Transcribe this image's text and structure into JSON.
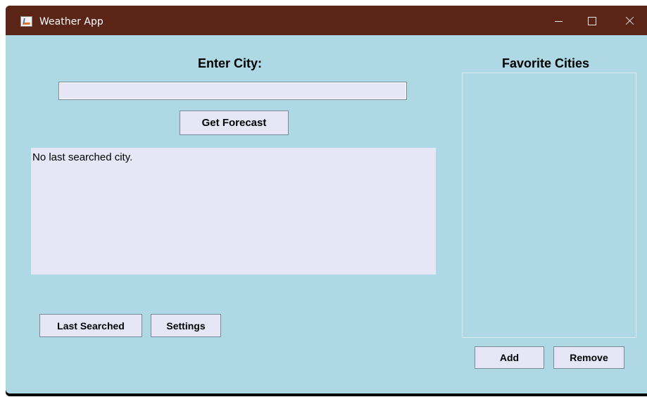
{
  "window": {
    "title": "Weather App",
    "icon": "java-app-icon",
    "controls": [
      "minimize-icon",
      "maximize-icon",
      "close-icon"
    ]
  },
  "search": {
    "label": "Enter City:",
    "input_value": "",
    "button_label": "Get Forecast"
  },
  "result": {
    "text": "No last searched city."
  },
  "bottom_buttons": {
    "last_searched_label": "Last Searched",
    "settings_label": "Settings"
  },
  "favorites": {
    "title": "Favorite Cities",
    "items": [],
    "add_label": "Add",
    "remove_label": "Remove"
  },
  "colors": {
    "titlebar": "#5a2417",
    "background": "#add8e4",
    "control_fill": "#e6e6f7"
  }
}
